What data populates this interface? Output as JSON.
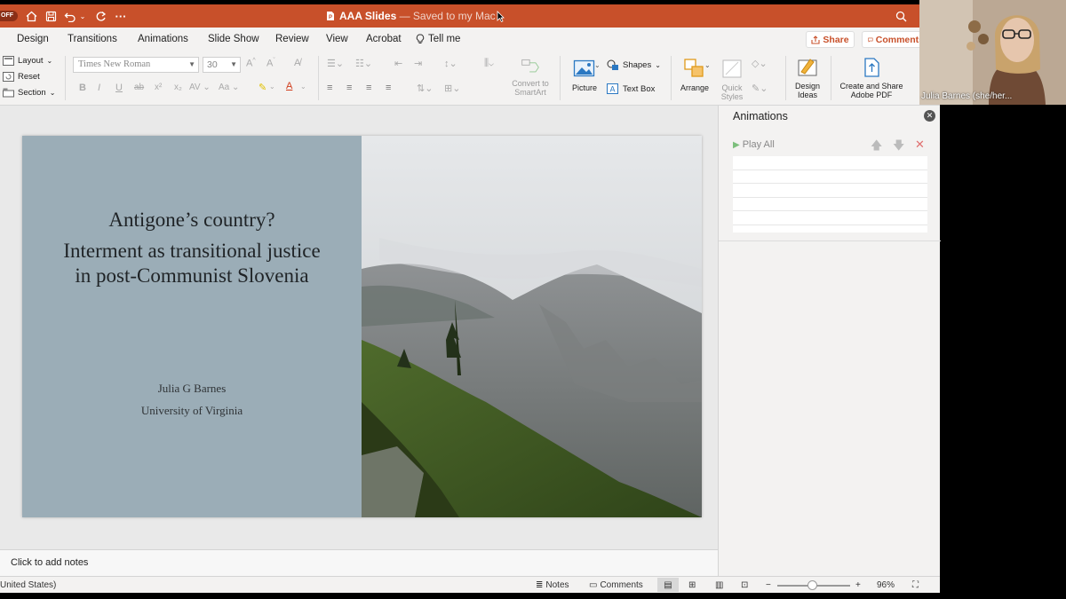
{
  "titlebar": {
    "autosave": "OFF",
    "doc_title": "AAA Slides",
    "saved_status": " — Saved to my Mac"
  },
  "tabs": [
    "Design",
    "Transitions",
    "Animations",
    "Slide Show",
    "Review",
    "View",
    "Acrobat",
    "Tell me"
  ],
  "share_label": "Share",
  "comments_label": "Comments",
  "ribbon": {
    "layout": "Layout",
    "reset": "Reset",
    "section": "Section",
    "font_name": "Times New Roman",
    "font_size": "30",
    "convert_smartart": "Convert to SmartArt",
    "picture": "Picture",
    "shapes": "Shapes",
    "text_box": "Text Box",
    "arrange": "Arrange",
    "quick_styles": "Quick Styles",
    "design_ideas": "Design Ideas",
    "create_share_pdf": "Create and Share Adobe PDF"
  },
  "slide": {
    "title_line1": "Antigone’s country?",
    "title_line2": "Interment as transitional justice in post-Communist Slovenia",
    "author": "Julia G Barnes",
    "affiliation": "University of Virginia"
  },
  "notes_placeholder": "Click to add notes",
  "animations_pane": {
    "title": "Animations",
    "play_all": "Play All"
  },
  "statusbar": {
    "language": "United States)",
    "notes": "Notes",
    "comments": "Comments",
    "zoom_level": "96%"
  },
  "webcam": {
    "participant_name": "Julia Barnes (she/her..."
  },
  "colors": {
    "accent": "#c8502a",
    "slide_panel": "#9badb7"
  }
}
